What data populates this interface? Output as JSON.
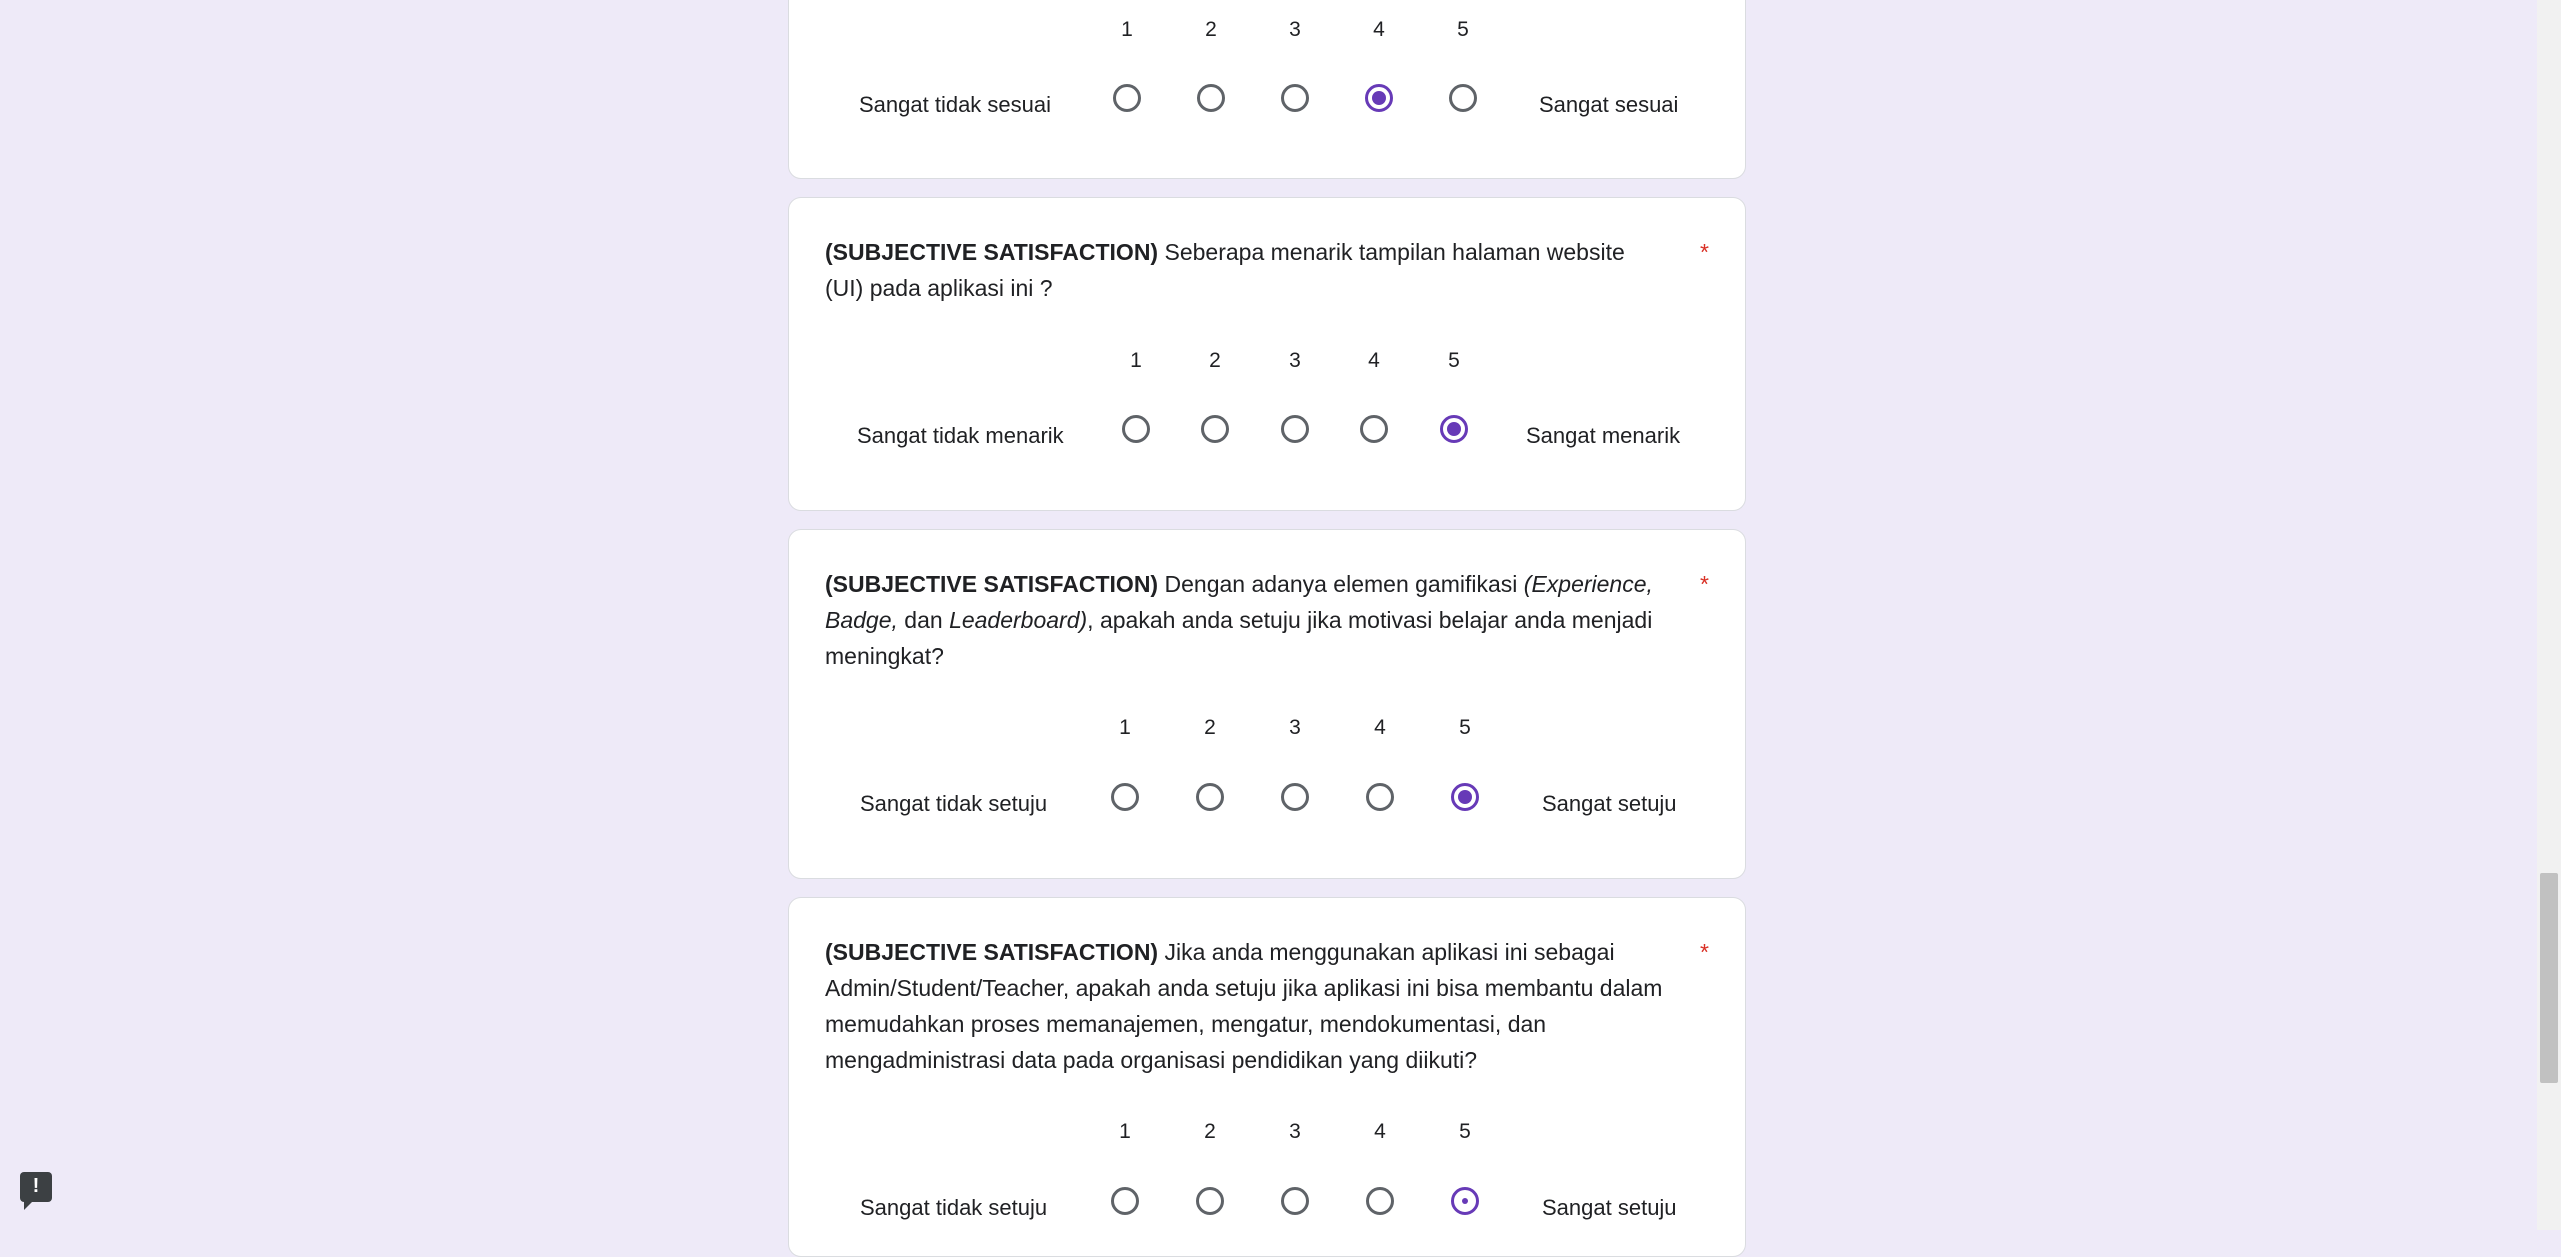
{
  "required_marker": "*",
  "questions": [
    {
      "prefix": "",
      "segments": [],
      "min_label": "Sangat tidak sesuai",
      "max_label": "Sangat sesuai",
      "scale": [
        "1",
        "2",
        "3",
        "4",
        "5"
      ],
      "selected": 4
    },
    {
      "prefix": "(SUBJECTIVE SATISFACTION)",
      "segments": [
        {
          "text": " Seberapa menarik tampilan halaman website (UI) pada aplikasi ini ?",
          "italic": false
        }
      ],
      "min_label": "Sangat tidak menarik",
      "max_label": "Sangat menarik",
      "scale": [
        "1",
        "2",
        "3",
        "4",
        "5"
      ],
      "selected": 5
    },
    {
      "prefix": "(SUBJECTIVE SATISFACTION)",
      "segments": [
        {
          "text": " Dengan adanya elemen gamifikasi ",
          "italic": false
        },
        {
          "text": "(Experience, Badge,",
          "italic": true
        },
        {
          "text": " dan ",
          "italic": false
        },
        {
          "text": "Leaderboard)",
          "italic": true
        },
        {
          "text": ", apakah anda setuju jika motivasi belajar anda menjadi meningkat?",
          "italic": false
        }
      ],
      "min_label": "Sangat tidak setuju",
      "max_label": "Sangat setuju",
      "scale": [
        "1",
        "2",
        "3",
        "4",
        "5"
      ],
      "selected": 5
    },
    {
      "prefix": "(SUBJECTIVE SATISFACTION)",
      "segments": [
        {
          "text": " Jika anda menggunakan aplikasi ini sebagai Admin/Student/Teacher, apakah anda setuju jika aplikasi ini bisa membantu dalam memudahkan proses memanajemen, mengatur, mendokumentasi, dan mengadministrasi data pada organisasi pendidikan yang diikuti?",
          "italic": false
        }
      ],
      "min_label": "Sangat tidak setuju",
      "max_label": "Sangat setuju",
      "scale": [
        "1",
        "2",
        "3",
        "4",
        "5"
      ],
      "selected": 0,
      "focused": 5
    }
  ],
  "feedback_icon": "feedback-icon",
  "feedback_glyph": "!",
  "colors": {
    "background": "#EEEAF8",
    "accent": "#673ab7",
    "required": "#d93025"
  }
}
